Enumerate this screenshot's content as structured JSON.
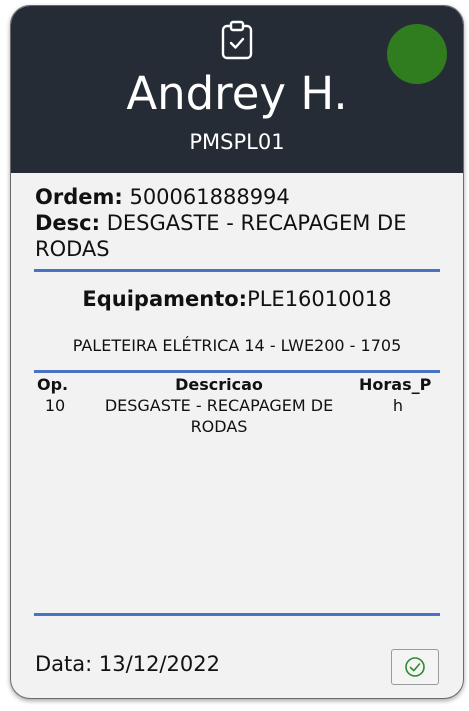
{
  "header": {
    "user_name": "Andrey H.",
    "user_code": "PMSPL01",
    "status_color": "#2f7d1f",
    "icon": "clipboard-check-icon"
  },
  "order": {
    "label": "Ordem:",
    "value": "500061888994",
    "desc_label": "Desc:",
    "desc_value": "DESGASTE - RECAPAGEM DE RODAS"
  },
  "equipment": {
    "label": "Equipamento:",
    "value": "PLE16010018",
    "description": "PALETEIRA ELÉTRICA 14 - LWE200 - 1705"
  },
  "operations": {
    "columns": [
      "Op.",
      "Descricao",
      "Horas_P"
    ],
    "rows": [
      {
        "op": "10",
        "desc_line1": "DESGASTE - RECAPAGEM DE",
        "desc_line2": "RODAS",
        "hours": "h"
      }
    ]
  },
  "footer": {
    "date_label": "Data:",
    "date_value": "13/12/2022",
    "confirm_icon": "check-circle-icon"
  },
  "colors": {
    "header_bg": "#252c36",
    "accent_rule": "#4a72c4",
    "confirm_icon": "#2f8a2f"
  }
}
